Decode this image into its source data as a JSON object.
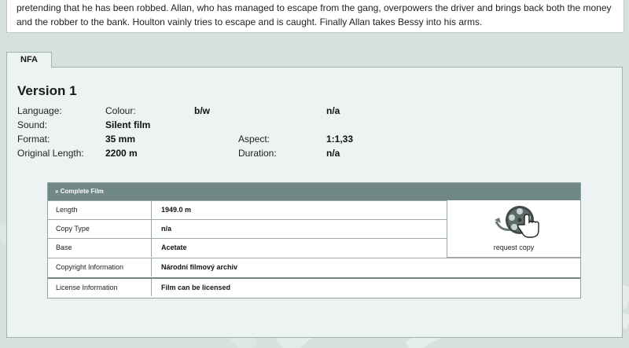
{
  "synopsis": {
    "text": "pretending that he has been robbed. Allan, who has managed to escape from the gang, overpowers the driver and brings back both the money and the robber to the bank. Houlton vainly tries to escape and is caught. Finally Allan takes Bessy into his arms."
  },
  "tab": {
    "label": "NFA"
  },
  "version": {
    "title": "Version 1",
    "language_label": "Language:",
    "colour_label": "Colour:",
    "colour_value": "b/w",
    "colour_extra": "n/a",
    "sound_label": "Sound:",
    "sound_value": "Silent film",
    "format_label": "Format:",
    "format_value": "35 mm",
    "aspect_label": "Aspect:",
    "aspect_value": "1:1,33",
    "length_label": "Original Length:",
    "length_value": "2200 m",
    "duration_label": "Duration:",
    "duration_value": "n/a"
  },
  "film": {
    "header": "» Complete Film",
    "rows": [
      {
        "key": "Length",
        "value": "1949.0 m"
      },
      {
        "key": "Copy Type",
        "value": "n/a"
      },
      {
        "key": "Base",
        "value": "Acetate"
      },
      {
        "key": "Copyright Information",
        "value": "Národní filmový archiv"
      },
      {
        "key": "License Information",
        "value": "Film can be licensed"
      }
    ],
    "request_label": "request copy",
    "request_icon": "film-reel-hand-icon"
  },
  "colors": {
    "background": "#d6e1df",
    "panel": "#edf3f2",
    "table_header": "#6f8785"
  }
}
